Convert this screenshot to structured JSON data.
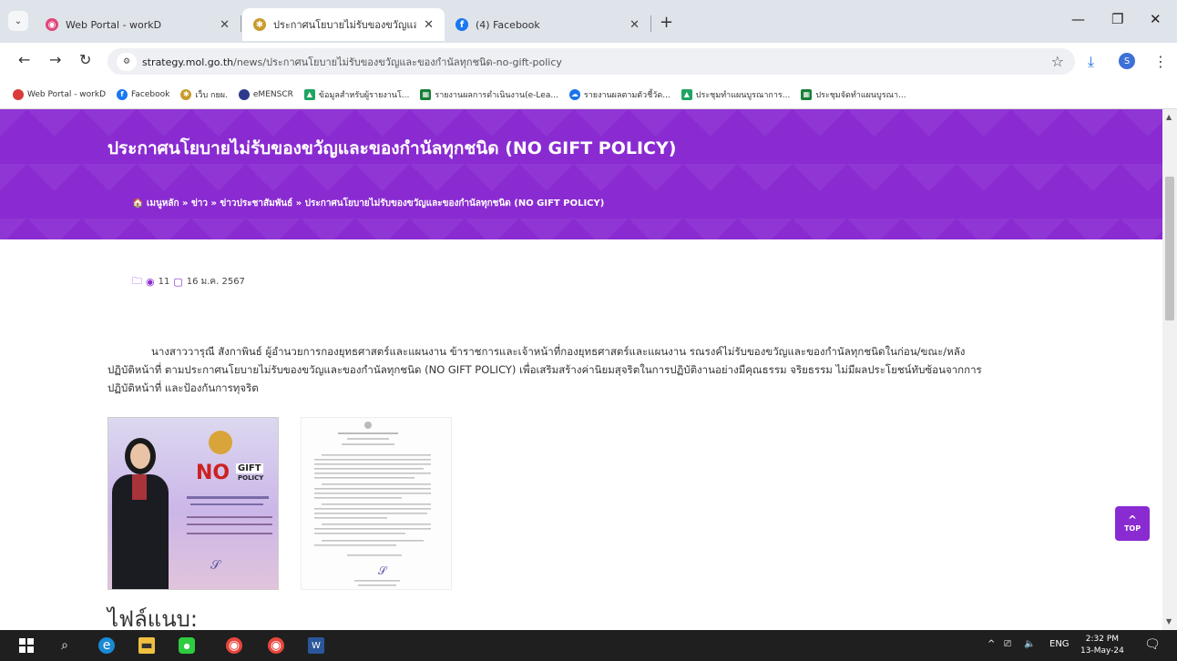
{
  "browser": {
    "tabs": [
      {
        "label": "Web Portal - workD",
        "active": false
      },
      {
        "label": "ประกาศนโยบายไม่รับของขวัญและขอ",
        "active": true
      },
      {
        "label": "(4) Facebook",
        "active": false
      }
    ],
    "new_tab": "+",
    "window_controls": [
      "—",
      "❐",
      "✕"
    ],
    "url_host": "strategy.mol.go.th",
    "url_path": "/news/ประกาศนโยบายไม่รับของขวัญและของกำนัลทุกชนิด-no-gift-policy",
    "profile_initial": "S",
    "bookmarks": [
      {
        "label": "Web Portal - workD",
        "icon_color": "#d93a3a"
      },
      {
        "label": "Facebook",
        "icon_color": "#1877f2"
      },
      {
        "label": "เว็บ กยผ.",
        "icon_color": "#c89b2c"
      },
      {
        "label": "eMENSCR",
        "icon_color": "#2d3a8c"
      },
      {
        "label": "ข้อมูลสำหรับผู้รายงานโ...",
        "icon_color": "#1fa463"
      },
      {
        "label": "รายงานผลการดำเนินงาน(e-Lea...",
        "icon_color": "#188038"
      },
      {
        "label": "รายงานผลตามตัวชี้วัด...",
        "icon_color": "#1a73e8"
      },
      {
        "label": "ประชุมทำแผนบูรณาการ...",
        "icon_color": "#1fa463"
      },
      {
        "label": "ประชุมจัดทำแผนบูรณา...",
        "icon_color": "#188038"
      }
    ]
  },
  "page": {
    "title": "ประกาศนโยบายไม่รับของขวัญและของกำนัลทุกชนิด (NO GIFT POLICY)",
    "breadcrumb": "🏠 เมนูหลัก » ข่าว » ข่าวประชาสัมพันธ์ » ประกาศนโยบายไม่รับของขวัญและของกำนัลทุกชนิด (NO GIFT POLICY)",
    "views": "11",
    "date": "16 ม.ค. 2567",
    "body": "นางสาววารุณี สังกาพินธ์ ผู้อำนวยการกองยุทธศาสตร์และแผนงาน ข้าราชการและเจ้าหน้าที่กองยุทธศาสตร์และแผนงาน รณรงค์ไม่รับของขวัญและของกำนัลทุกชนิดในก่อน/ขณะ/หลังปฏิบัติหน้าที่ ตามประกาศนโยบายไม่รับของขวัญและของกำนัลทุกชนิด (NO GIFT POLICY) เพื่อเสริมสร้างค่านิยมสุจริตในการปฏิบัติงานอย่างมีคุณธรรม จริยธรรม ไม่มีผลประโยชน์ทับซ้อนจากการปฏิบัติหน้าที่ และป้องกันการทุจริต",
    "poster_no": "NO",
    "poster_gift": "GIFT",
    "poster_policy": "POLICY",
    "attachments_heading": "ไฟล์แนบ:",
    "top_button": "TOP"
  },
  "taskbar": {
    "lang": "ENG",
    "time": "2:32 PM",
    "date": "13-May-24"
  },
  "colors": {
    "accent": "#8a2bd2"
  }
}
